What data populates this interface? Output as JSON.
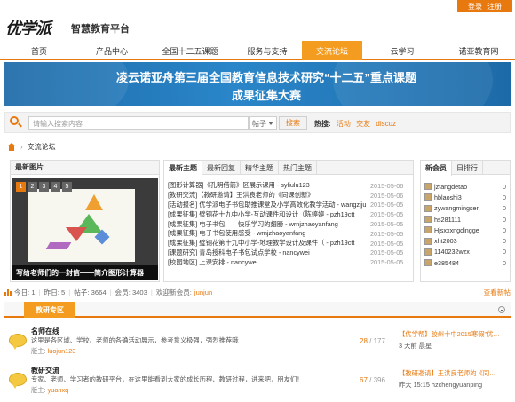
{
  "header": {
    "login": "登录",
    "register": "注册",
    "logo": "优学派",
    "platform": "智慧教育平台"
  },
  "nav": {
    "items": [
      "首页",
      "产品中心",
      "全国十二五课题",
      "服务与支持",
      "交流论坛",
      "云学习",
      "诺亚教育网"
    ],
    "active": "交流论坛",
    "accent": "#e8790e"
  },
  "banner": {
    "line1": "凌云诺亚舟第三届全国教育信息技术研究“十二五”重点课题",
    "line2": "成果征集大赛"
  },
  "search": {
    "placeholder": "请输入搜索内容",
    "scope": "帖子",
    "button": "搜索",
    "hot_label": "热搜:",
    "hot": [
      "活动",
      "交友",
      "discuz"
    ]
  },
  "breadcrumb": {
    "current": "交流论坛"
  },
  "featured": {
    "title": "最新图片",
    "pages": [
      "1",
      "2",
      "3",
      "4",
      "5"
    ],
    "active_page": 1,
    "caption": "写给老师们的一封信——简介图形计算器"
  },
  "topics": {
    "tabs": [
      "最新主题",
      "最新回复",
      "精华主题",
      "热门主题"
    ],
    "active_tab": "最新主题",
    "items": [
      {
        "title": "[图形计算器]《孔明借箭》区展示课用 - syliulu123",
        "date": "2015-05-06"
      },
      {
        "title": "[教研交流]【教研邀请】王洪良老师的《同课创新》",
        "date": "2015-05-06"
      },
      {
        "title": "[活动报名] 优学派电子书包助推课堂及小学高效化教学活动 - wangzjju",
        "date": "2015-05-05"
      },
      {
        "title": "[成果征集] 璧铜花十九中小学-互动课件和设计（陈婷婷 - pzh19ctt",
        "date": "2015-05-05"
      },
      {
        "title": "[成果征集] 电子书包——快乐学习的翅膀 - wrnjzhaoyanfang",
        "date": "2015-05-05"
      },
      {
        "title": "[成果征集] 电子书包使用感受 - wrnjzhaoyanfang",
        "date": "2015-05-05"
      },
      {
        "title": "[成果征集] 璧铜花第十九中小学-地理教学设计及课件（ - pzh19ctt",
        "date": "2015-05-05"
      },
      {
        "title": "[课题研究] 青岛授科电子书包试点学校 - nancywei",
        "date": "2015-05-05"
      },
      {
        "title": "[校园地区] 上课安排 - nancywei",
        "date": "2015-05-05"
      }
    ]
  },
  "members": {
    "tabs": [
      "新会员",
      "日排行"
    ],
    "active_tab": "新会员",
    "items": [
      {
        "name": "jztangdetao",
        "num": "0"
      },
      {
        "name": "hblaoshi3",
        "num": "0"
      },
      {
        "name": "zywangmingsen",
        "num": "0"
      },
      {
        "name": "hs281111",
        "num": "0"
      },
      {
        "name": "Hjsxxxngdingge",
        "num": "0"
      },
      {
        "name": "xht2003",
        "num": "0"
      },
      {
        "name": "1140232wzx",
        "num": "0"
      },
      {
        "name": "e385484",
        "num": "0"
      }
    ]
  },
  "stats": {
    "today": "今日: 1",
    "yesterday": "昨日: 5",
    "posts": "帖子: 3664",
    "members": "会员: 3403",
    "welcome_label": "欢迎新会员:",
    "newest": "junjun",
    "view_new": "查看新帖"
  },
  "section": {
    "label": "教研专区"
  },
  "forums": [
    {
      "name": "名师在线",
      "desc": "这里是各区域、学校、老师的各确活动展示，参考意义极强，强烈推荐哦",
      "mod_label": "版主:",
      "mod": "luojun123",
      "topics": "28",
      "posts": "177",
      "last_title": "【优学帮】胶州十中2015寒假\"优…",
      "last_meta": "3 天前 晨星"
    },
    {
      "name": "教研交流",
      "desc": "专家、老师、学习者的教研平台，在这里能看到大家的成长历程、教研过程，进来吧，朋友们！",
      "mod_label": "版主:",
      "mod": "yuanxq",
      "topics": "67",
      "posts": "396",
      "last_title": "【教研邀请】王洪良老师的《同…",
      "last_meta": "昨天 15:15 hzchengyuanping"
    }
  ]
}
